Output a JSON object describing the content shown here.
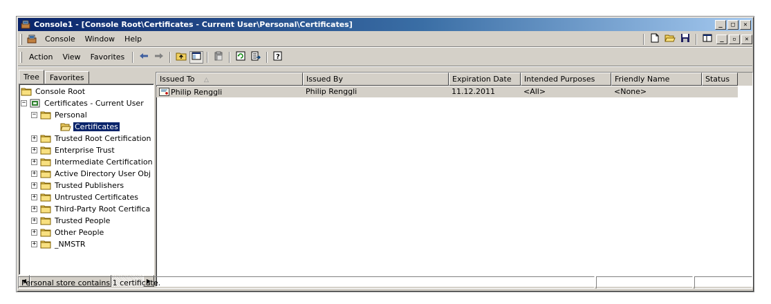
{
  "window": {
    "title": "Console1 - [Console Root\\Certificates - Current User\\Personal\\Certificates]",
    "minimize": "_",
    "maximize": "□",
    "close": "✕"
  },
  "menubar": {
    "items": [
      "Console",
      "Window",
      "Help"
    ],
    "inner_minimize": "_",
    "inner_restore": "▫",
    "inner_close": "✕"
  },
  "toolbar": {
    "items": [
      "Action",
      "View",
      "Favorites"
    ]
  },
  "tabs": [
    "Tree",
    "Favorites"
  ],
  "tree": [
    {
      "label": "Console Root",
      "level": 0,
      "expander": ""
    },
    {
      "label": "Certificates - Current User",
      "level": 0,
      "expander": "−"
    },
    {
      "label": "Personal",
      "level": 1,
      "expander": "−"
    },
    {
      "label": "Certificates",
      "level": 2,
      "expander": "",
      "selected": true
    },
    {
      "label": "Trusted Root Certification",
      "level": 1,
      "expander": "+"
    },
    {
      "label": "Enterprise Trust",
      "level": 1,
      "expander": "+"
    },
    {
      "label": "Intermediate Certification",
      "level": 1,
      "expander": "+"
    },
    {
      "label": "Active Directory User Obj",
      "level": 1,
      "expander": "+"
    },
    {
      "label": "Trusted Publishers",
      "level": 1,
      "expander": "+"
    },
    {
      "label": "Untrusted Certificates",
      "level": 1,
      "expander": "+"
    },
    {
      "label": "Third-Party Root Certifica",
      "level": 1,
      "expander": "+"
    },
    {
      "label": "Trusted People",
      "level": 1,
      "expander": "+"
    },
    {
      "label": "Other People",
      "level": 1,
      "expander": "+"
    },
    {
      "label": "_NMSTR",
      "level": 1,
      "expander": "+"
    }
  ],
  "list": {
    "columns": [
      "Issued To",
      "Issued By",
      "Expiration Date",
      "Intended Purposes",
      "Friendly Name",
      "Status"
    ],
    "sort_indicator": "△",
    "rows": [
      [
        "Philip Renggli",
        "Philip Renggli",
        "11.12.2011",
        "<All>",
        "<None>",
        ""
      ]
    ]
  },
  "statusbar": {
    "text": "Personal store contains 1 certificate."
  },
  "colors": {
    "title_active": "#0a246a",
    "selection": "#0a246a",
    "face": "#d4d0c8"
  }
}
